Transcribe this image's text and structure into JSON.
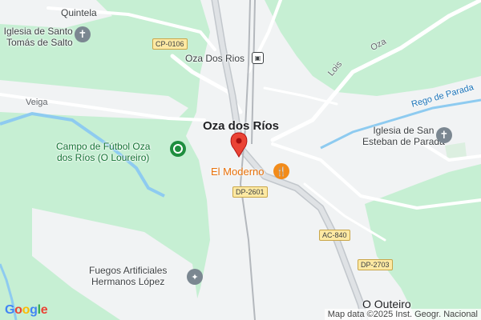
{
  "map": {
    "colors": {
      "land": "#f1f3f4",
      "green": "#c6efd3",
      "water": "#8ecbf0",
      "road": "#ffffff",
      "highway": "#c2c7cc",
      "rail": "#b4b8bd",
      "pin": "#ea4335"
    },
    "places": {
      "quintela": "Quintela",
      "church_salto_line1": "Iglesia de Santo",
      "church_salto_line2": "Tomás de Salto",
      "station": "Oza Dos Rios",
      "town": "Oza dos Ríos",
      "football_line1": "Campo de Fútbol Oza",
      "football_line2": "dos Ríos (O Loureiro)",
      "restaurant": "El Moderno",
      "church_parada_line1": "Iglesia de San",
      "church_parada_line2": "Esteban de Parada",
      "fireworks_line1": "Fuegos Artificiales",
      "fireworks_line2": "Hermanos López",
      "outeiro": "O Outeiro",
      "veiga": "Veiga",
      "lois": "Lois",
      "oza": "Oza",
      "river": "Rego de Parada"
    },
    "road_shields": {
      "cp0106": "CP-0106",
      "dp2601": "DP-2601",
      "ac840": "AC-840",
      "dp2703": "DP-2703"
    },
    "icons": {
      "church": "church-icon",
      "park": "park-icon",
      "restaurant": "restaurant-icon",
      "station": "train-station-icon",
      "pin": "location-pin-icon"
    },
    "logo": [
      "G",
      "o",
      "o",
      "g",
      "l",
      "e"
    ],
    "logo_colors": [
      "#4285f4",
      "#ea4335",
      "#fbbc05",
      "#4285f4",
      "#34a853",
      "#ea4335"
    ],
    "attribution": "Map data ©2025 Inst. Geogr. Nacional"
  }
}
